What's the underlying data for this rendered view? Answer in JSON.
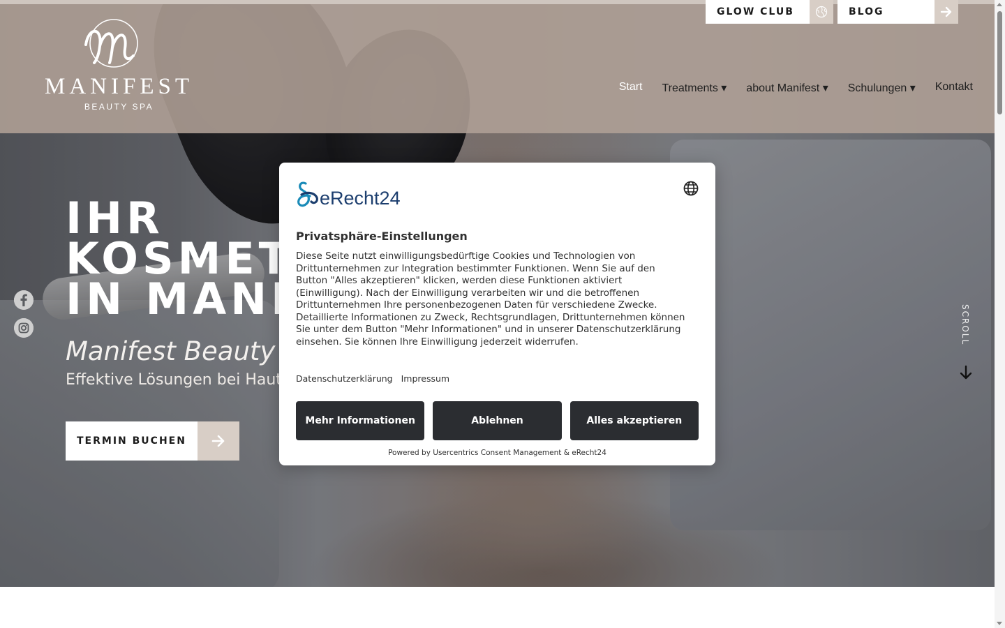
{
  "header": {
    "logo": {
      "wordmark": "MANIFEST",
      "subtitle": "BEAUTY SPA"
    },
    "top_buttons": [
      {
        "label": "GLOW CLUB",
        "icon": "globe-icon"
      },
      {
        "label": "BLOG",
        "icon": "arrow-right-icon"
      }
    ],
    "nav": [
      {
        "label": "Start",
        "active": true
      },
      {
        "label": "Treatments ▾"
      },
      {
        "label": "about Manifest ▾"
      },
      {
        "label": "Schulungen ▾"
      },
      {
        "label": "Kontakt"
      }
    ]
  },
  "hero": {
    "headline": [
      "IHR",
      "KOSMET",
      "IN MANI"
    ],
    "tagline": "Manifest Beauty",
    "subline": "Effektive Lösungen bei Haut",
    "cta": {
      "label": "TERMIN BUCHEN",
      "icon": "arrow-right-icon"
    },
    "social": [
      "facebook-icon",
      "instagram-icon"
    ],
    "scroll_label": "SCROLL"
  },
  "consent": {
    "brand": "eRecht24",
    "title": "Privatsphäre-Einstellungen",
    "body": "Diese Seite nutzt einwilligungsbedürftige Cookies und Technologien von Drittunternehmen zur Integration bestimmter Funktionen. Wenn Sie auf den Button \"Alles akzeptieren\" klicken, werden diese Funktionen aktiviert (Einwilligung). Nach der Einwilligung verarbeiten wir und die betroffenen Drittunternehmen Ihre personenbezogenen Daten für verschiedene Zwecke. Detaillierte Informationen zu Zweck, Rechtsgrundlagen, Drittunternehmen können Sie unter dem Button \"Mehr Informationen\" und in unserer Datenschutzerklärung einsehen. Sie können Ihre Einwilligung jederzeit widerrufen.",
    "links": [
      "Datenschutzerklärung",
      "Impressum"
    ],
    "buttons": [
      "Mehr Informationen",
      "Ablehnen",
      "Alles akzeptieren"
    ],
    "powered_by": "Powered by Usercentrics Consent Management & eRecht24"
  },
  "colors": {
    "header_band": "#b0a096",
    "accent_square": "#d8cec6",
    "modal_button": "#2b2d31",
    "brand_teal": "#1a8bb8",
    "brand_navy": "#1c3e6e"
  }
}
